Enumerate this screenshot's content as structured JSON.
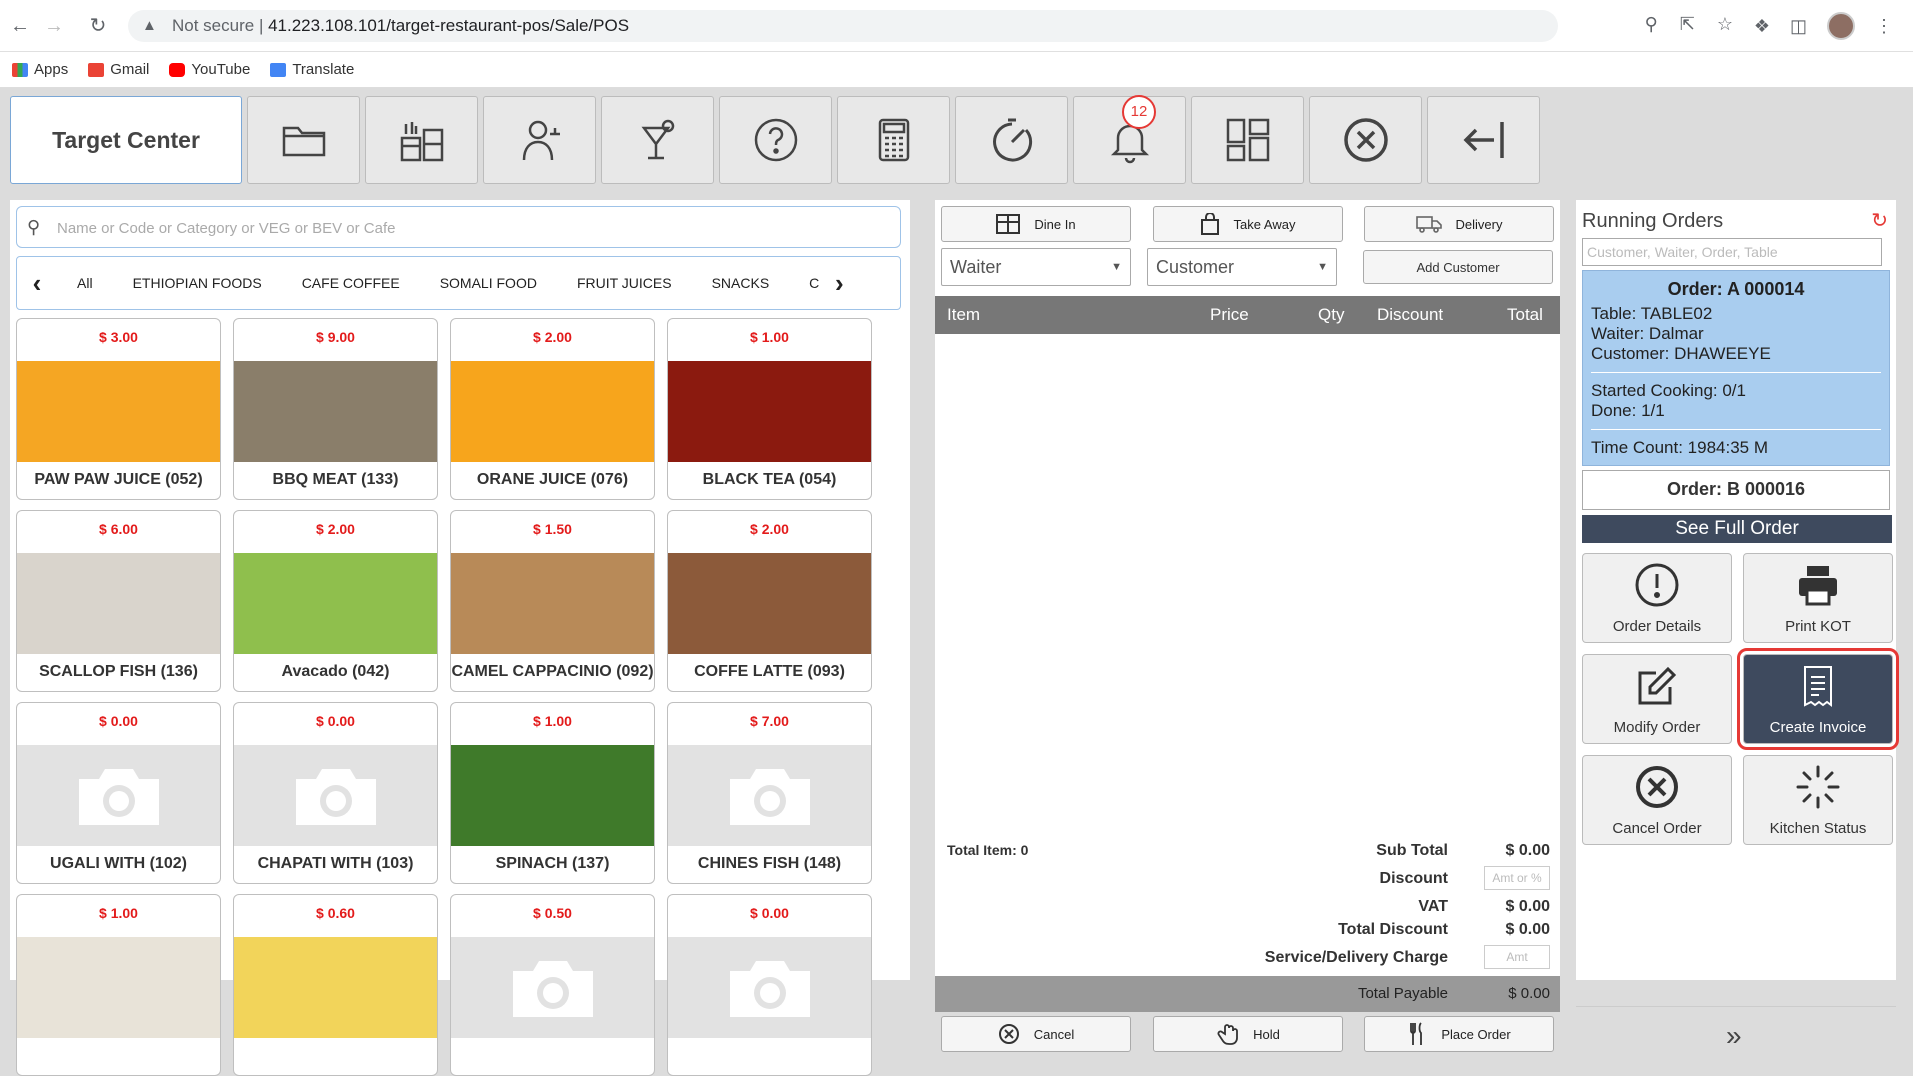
{
  "browser": {
    "security": "Not secure",
    "url": "41.223.108.101/target-restaurant-pos/Sale/POS",
    "bookmarks": [
      "Apps",
      "Gmail",
      "YouTube",
      "Translate"
    ]
  },
  "topbar": {
    "brand": "Target Center",
    "notification_count": "12"
  },
  "search": {
    "placeholder": "Name or Code or Category or VEG or BEV or Cafe"
  },
  "categories": [
    "All",
    "ETHIOPIAN FOODS",
    "CAFE COFFEE",
    "SOMALI FOOD",
    "FRUIT JUICES",
    "SNACKS",
    "C"
  ],
  "items": [
    {
      "price": "$ 3.00",
      "name": "PAW PAW JUICE (052)",
      "img": "#f5a623"
    },
    {
      "price": "$ 9.00",
      "name": "BBQ MEAT (133)",
      "img": "#8a7e6a"
    },
    {
      "price": "$ 2.00",
      "name": "ORANE JUICE (076)",
      "img": "#f7a51c"
    },
    {
      "price": "$ 1.00",
      "name": "BLACK TEA (054)",
      "img": "#8b1a0f"
    },
    {
      "price": "$ 6.00",
      "name": "SCALLOP FISH (136)",
      "img": "#d9d4cc"
    },
    {
      "price": "$ 2.00",
      "name": "Avacado (042)",
      "img": "#8fbf4d"
    },
    {
      "price": "$ 1.50",
      "name": "CAMEL CAPPACINIO (092)",
      "img": "#b88a58"
    },
    {
      "price": "$ 2.00",
      "name": "COFFE LATTE (093)",
      "img": "#8c5a3a"
    },
    {
      "price": "$ 0.00",
      "name": "UGALI WITH (102)",
      "img": ""
    },
    {
      "price": "$ 0.00",
      "name": "CHAPATI WITH (103)",
      "img": ""
    },
    {
      "price": "$ 1.00",
      "name": "SPINACH (137)",
      "img": "#3f7a2a"
    },
    {
      "price": "$ 7.00",
      "name": "CHINES FISH (148)",
      "img": ""
    },
    {
      "price": "$ 1.00",
      "name": "",
      "img": "#e8e3d8"
    },
    {
      "price": "$ 0.60",
      "name": "",
      "img": "#f2d45a"
    },
    {
      "price": "$ 0.50",
      "name": "",
      "img": ""
    },
    {
      "price": "$ 0.00",
      "name": "",
      "img": ""
    }
  ],
  "order": {
    "dine_in": "Dine In",
    "take_away": "Take Away",
    "delivery": "Delivery",
    "waiter": "Waiter",
    "customer": "Customer",
    "add_customer": "Add Customer",
    "columns": [
      "Item",
      "Price",
      "Qty",
      "Discount",
      "Total"
    ],
    "total_item": "Total Item: 0",
    "sub_total_label": "Sub Total",
    "sub_total": "$ 0.00",
    "discount_label": "Discount",
    "discount_placeholder": "Amt or %",
    "vat_label": "VAT",
    "vat": "$ 0.00",
    "total_discount_label": "Total Discount",
    "total_discount": "$ 0.00",
    "service_label": "Service/Delivery Charge",
    "service_placeholder": "Amt",
    "payable_label": "Total Payable",
    "payable": "$ 0.00",
    "cancel": "Cancel",
    "hold": "Hold",
    "place_order": "Place Order"
  },
  "running": {
    "title": "Running Orders",
    "search_placeholder": "Customer, Waiter, Order, Table",
    "order1": {
      "head": "Order: A 000014",
      "table": "Table: TABLE02",
      "waiter": "Waiter: Dalmar",
      "customer": "Customer: DHAWEEYE",
      "started": "Started Cooking: 0/1",
      "done": "Done: 1/1",
      "time": "Time Count: 1984:35 M"
    },
    "order2_head": "Order: B 000016",
    "see_full": "See Full Order",
    "actions": [
      "Order Details",
      "Print KOT",
      "Modify Order",
      "Create Invoice",
      "Cancel Order",
      "Kitchen Status"
    ]
  }
}
